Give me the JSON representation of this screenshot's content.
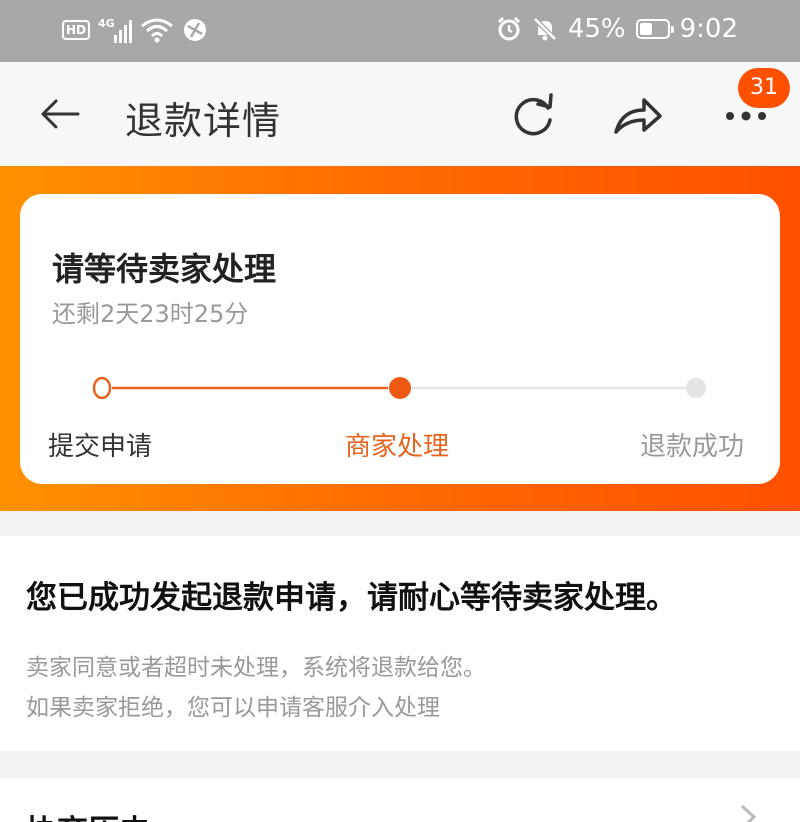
{
  "status_bar": {
    "hd": "HD",
    "network": "4G",
    "battery_percent": "45%",
    "time": "9:02",
    "battery_level": 0.45
  },
  "nav": {
    "title": "退款详情",
    "badge_count": "31",
    "icons": [
      "back-arrow-icon",
      "refresh-icon",
      "share-icon",
      "more-icon"
    ]
  },
  "status_card": {
    "title": "请等待卖家处理",
    "remaining": "还剩2天23时25分",
    "steps": [
      "提交申请",
      "商家处理",
      "退款成功"
    ],
    "current_step": 2
  },
  "message": {
    "title": "您已成功发起退款申请，请耐心等待卖家处理。",
    "line1": "卖家同意或者超时未处理，系统将退款给您。",
    "line2": "如果卖家拒绝，您可以申请客服介入处理"
  },
  "history": {
    "title": "协商历史"
  },
  "colors": {
    "accent": "#ff5000",
    "step_active": "#e8641e",
    "status_bar": "#a8a8a8"
  }
}
